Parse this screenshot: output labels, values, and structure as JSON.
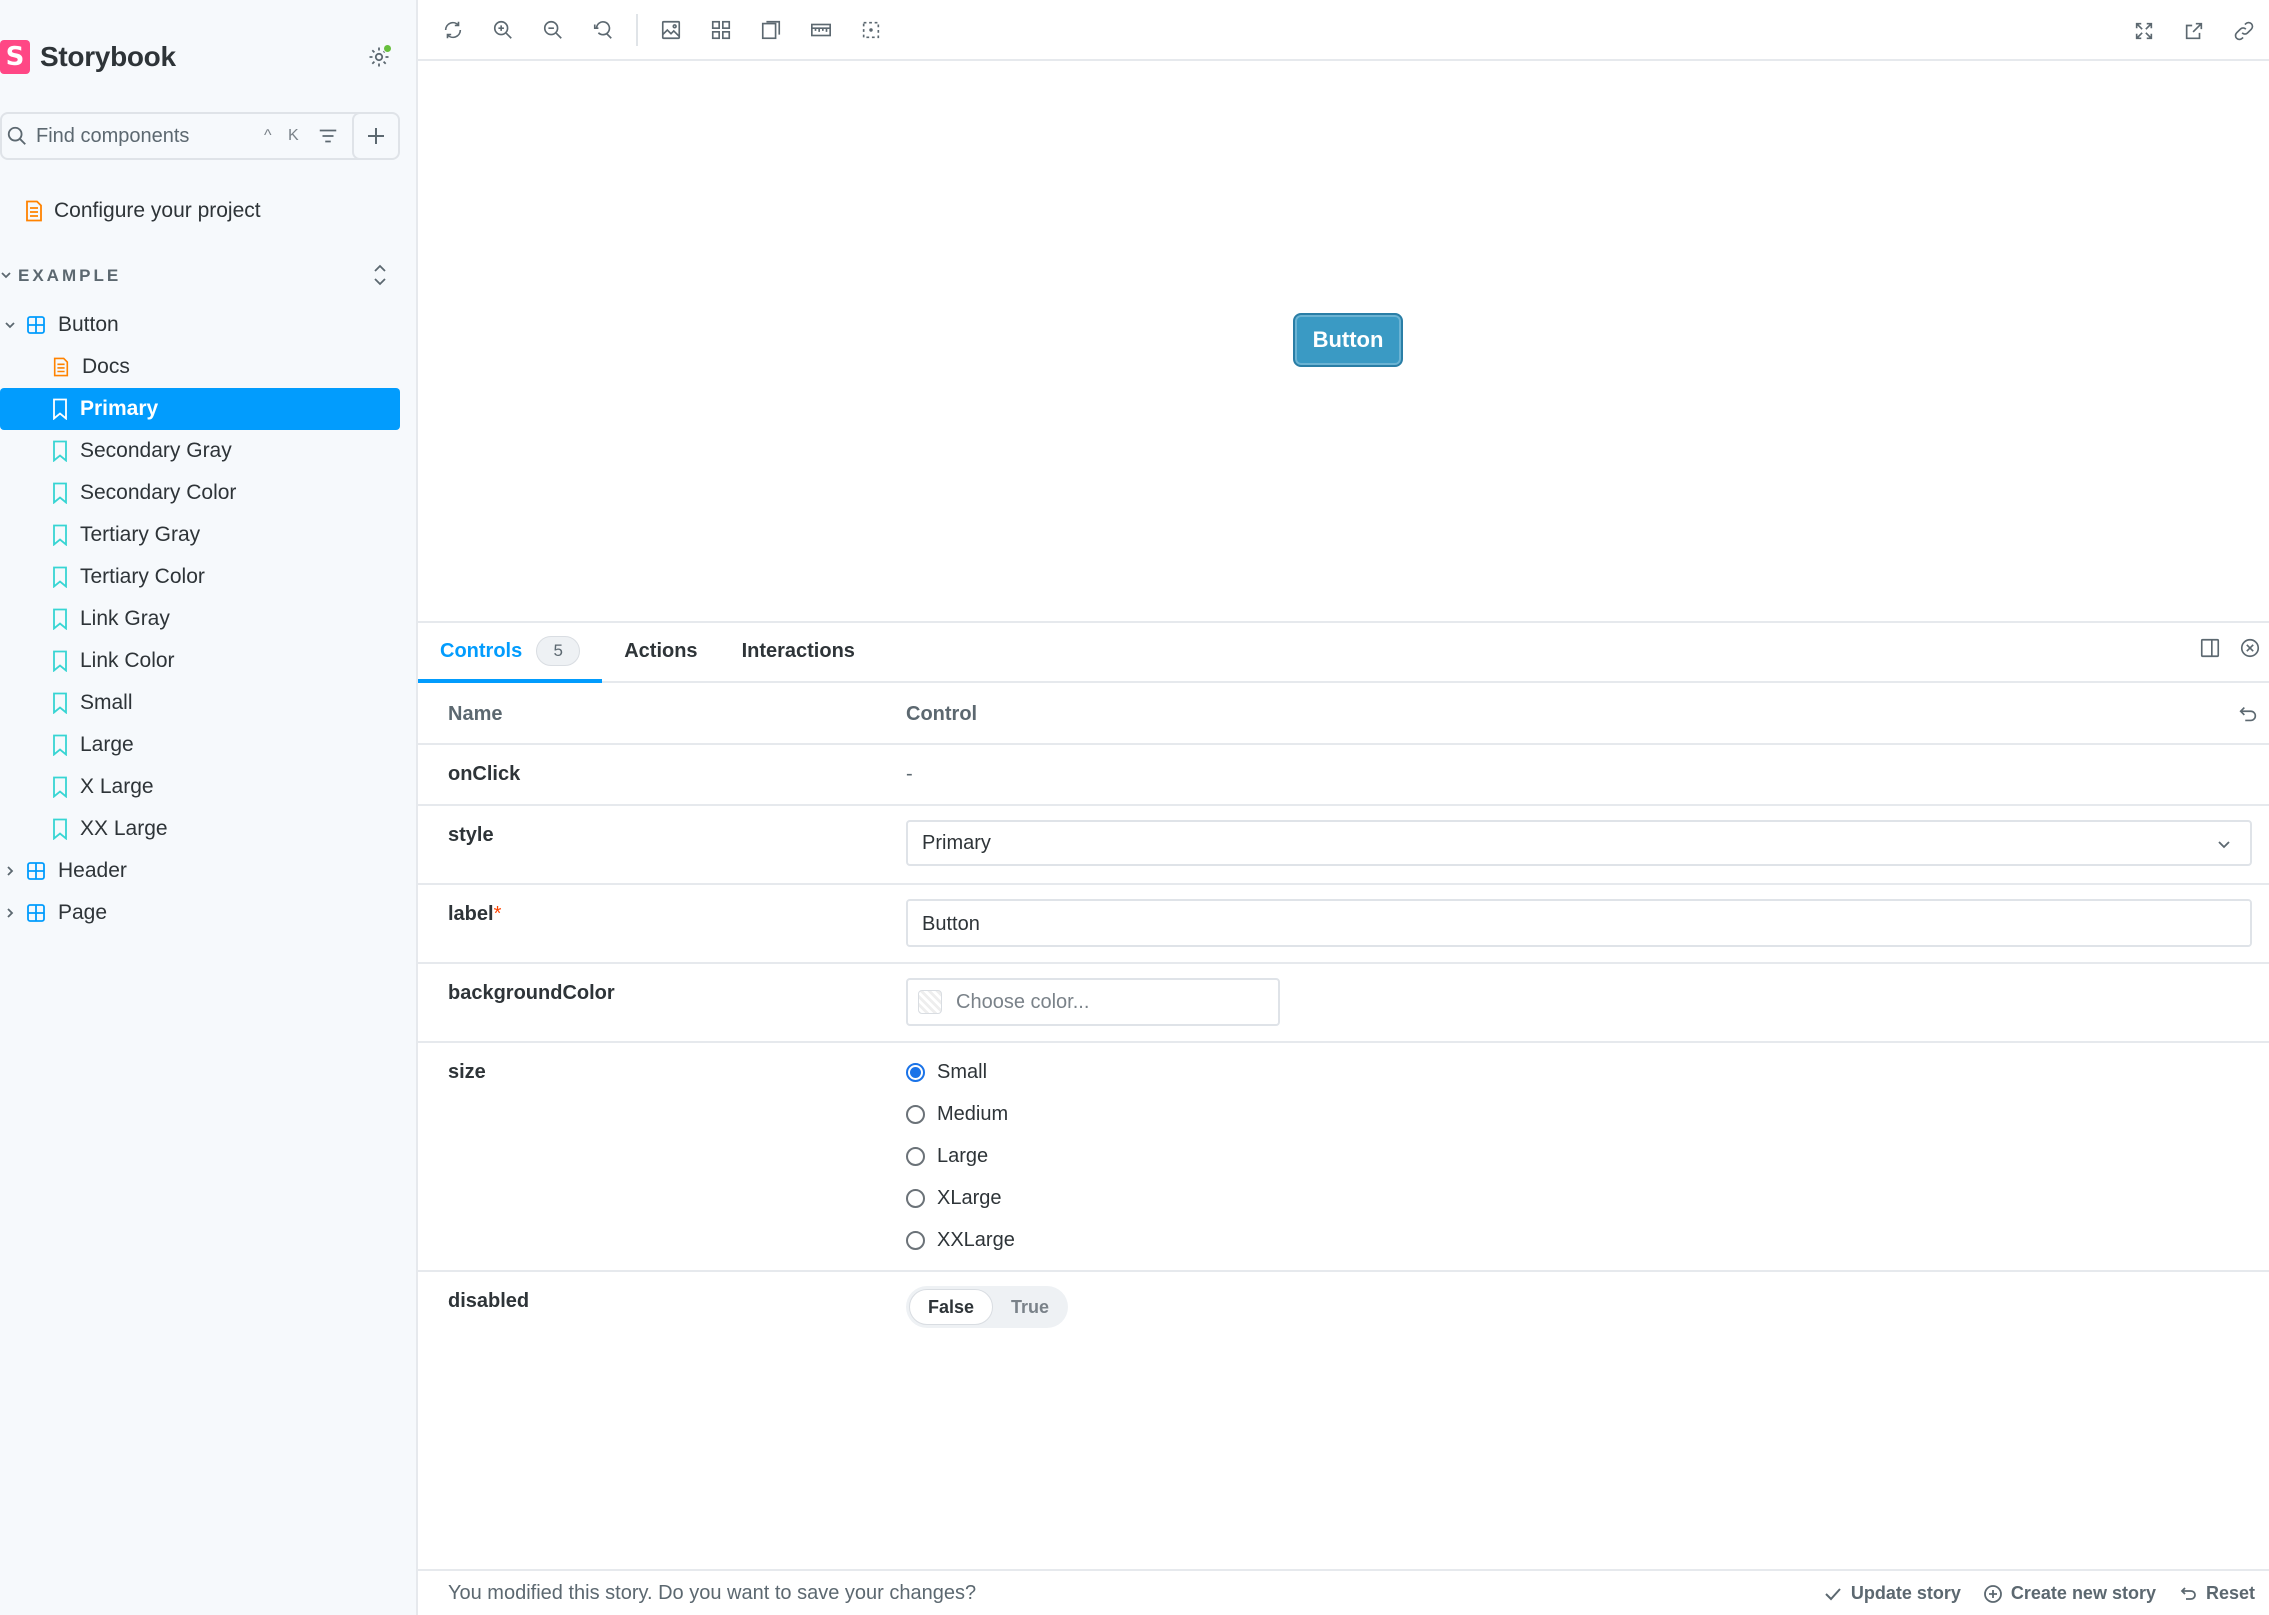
{
  "sidebar": {
    "brand": {
      "logo": "S",
      "name": "Storybook"
    },
    "search": {
      "placeholder": "Find components",
      "shortcut": "^ K"
    },
    "configure": "Configure your project",
    "section": "EXAMPLE",
    "items": [
      {
        "label": "Button",
        "kind": "component"
      },
      {
        "label": "Docs",
        "kind": "docs"
      },
      {
        "label": "Primary",
        "kind": "story"
      },
      {
        "label": "Secondary Gray",
        "kind": "story"
      },
      {
        "label": "Secondary Color",
        "kind": "story"
      },
      {
        "label": "Tertiary Gray",
        "kind": "story"
      },
      {
        "label": "Tertiary Color",
        "kind": "story"
      },
      {
        "label": "Link Gray",
        "kind": "story"
      },
      {
        "label": "Link Color",
        "kind": "story"
      },
      {
        "label": "Small",
        "kind": "story"
      },
      {
        "label": "Large",
        "kind": "story"
      },
      {
        "label": "X Large",
        "kind": "story"
      },
      {
        "label": "XX Large",
        "kind": "story"
      },
      {
        "label": "Header",
        "kind": "component"
      },
      {
        "label": "Page",
        "kind": "component"
      }
    ]
  },
  "preview": {
    "button_label": "Button",
    "button_color": "#3a9ac4"
  },
  "panel": {
    "tabs": {
      "controls": "Controls",
      "controls_count": "5",
      "actions": "Actions",
      "interactions": "Interactions"
    },
    "header": {
      "name": "Name",
      "control": "Control"
    },
    "rows": {
      "onClick": {
        "name": "onClick",
        "value": "-"
      },
      "style": {
        "name": "style",
        "value": "Primary"
      },
      "label": {
        "name": "label",
        "required": "*",
        "value": "Button"
      },
      "backgroundColor": {
        "name": "backgroundColor",
        "placeholder": "Choose color..."
      },
      "size": {
        "name": "size",
        "options": [
          "Small",
          "Medium",
          "Large",
          "XLarge",
          "XXLarge"
        ],
        "selected": "Small"
      },
      "disabled": {
        "name": "disabled",
        "false_label": "False",
        "true_label": "True"
      }
    },
    "footer": {
      "message": "You modified this story. Do you want to save your changes?",
      "update": "Update story",
      "create": "Create new story",
      "reset": "Reset"
    }
  },
  "colors": {
    "accent": "#029cfd",
    "brand": "#ff4785",
    "story_icon": "#37d5d3",
    "docs_icon": "#ff8300",
    "component_icon": "#029cfd"
  }
}
